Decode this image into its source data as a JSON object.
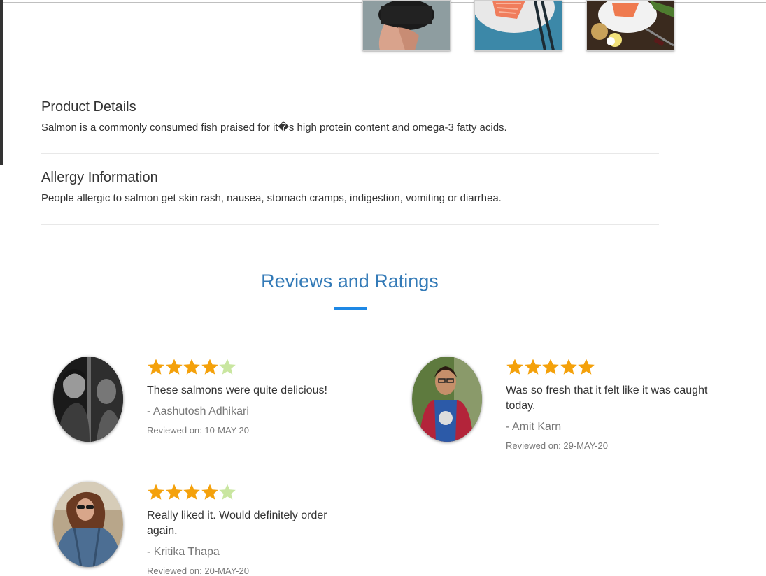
{
  "gallery": {
    "thumbnails": [
      {
        "subject": "hand-holding-bowl"
      },
      {
        "subject": "salmon-fillet-on-blue-plate"
      },
      {
        "subject": "salmon-with-lemon-and-herbs"
      }
    ]
  },
  "product": {
    "details_title": "Product Details",
    "details_text": "Salmon is a commonly consumed fish praised for it�s high protein content and omega-3 fatty acids.",
    "allergy_title": "Allergy Information",
    "allergy_text": "People allergic to salmon get skin rash, nausea, stomach cramps, indigestion, vomiting or diarrhea."
  },
  "reviews": {
    "title": "Reviews and Ratings",
    "items": [
      {
        "rating": 4,
        "max_rating": 5,
        "text": "These salmons were quite delicious!",
        "author": "- Aashutosh Adhikari",
        "date": "Reviewed on: 10-MAY-20"
      },
      {
        "rating": 5,
        "max_rating": 5,
        "text": "Was so fresh that it felt like it was caught today.",
        "author": "- Amit Karn",
        "date": "Reviewed on: 29-MAY-20"
      },
      {
        "rating": 4,
        "max_rating": 5,
        "text": "Really liked it. Would definitely order again.",
        "author": "- Kritika Thapa",
        "date": "Reviewed on: 20-MAY-20"
      }
    ]
  },
  "colors": {
    "star_filled": "#f4a10b",
    "star_empty": "#c9e6a0",
    "heading_blue": "#337ab7",
    "underline_blue": "#1e88e5"
  }
}
